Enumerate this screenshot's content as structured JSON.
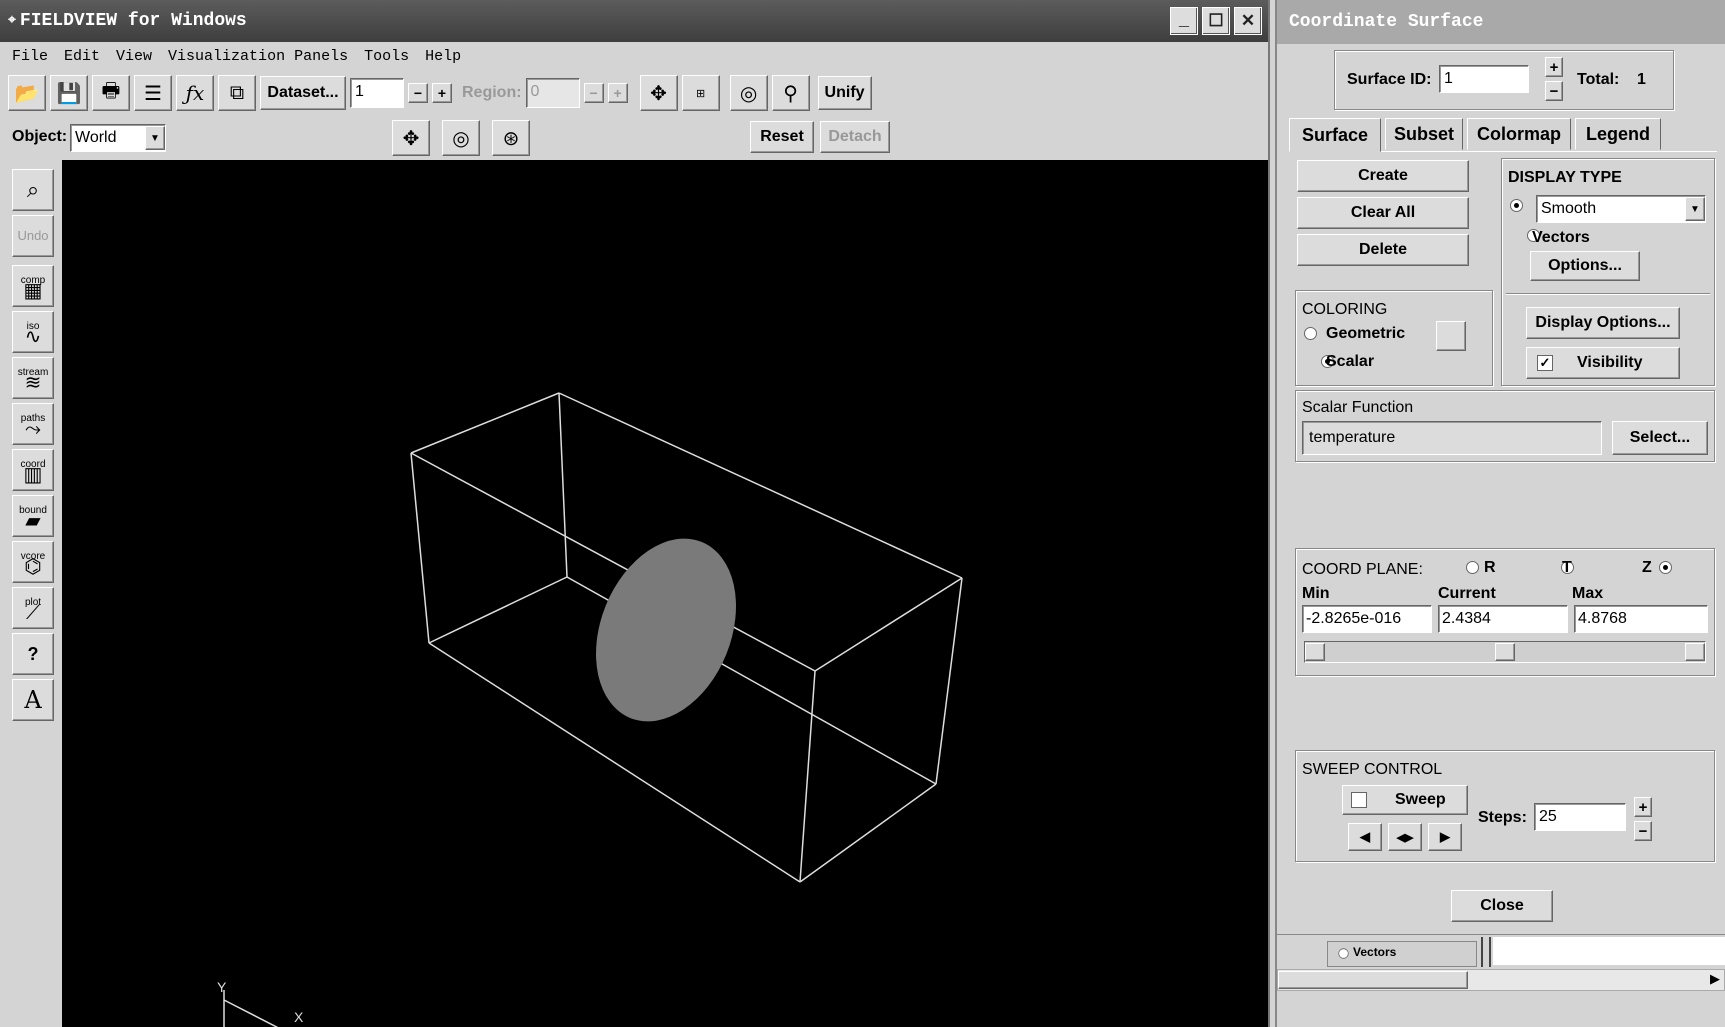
{
  "main_window": {
    "title": "FIELDVIEW for Windows",
    "menu": [
      "File",
      "Edit",
      "View",
      "Visualization Panels",
      "Tools",
      "Help"
    ],
    "toolbar": {
      "dataset_label": "Dataset...",
      "dataset_value": "1",
      "region_label": "Region:",
      "region_value": "0",
      "unify_label": "Unify"
    },
    "object_bar": {
      "label": "Object:",
      "value": "World",
      "reset_label": "Reset",
      "detach_label": "Detach"
    },
    "left_toolbar": [
      {
        "name": "probe",
        "label": ""
      },
      {
        "name": "undo",
        "label": "Undo"
      },
      {
        "name": "comp",
        "label": "comp"
      },
      {
        "name": "iso",
        "label": "iso"
      },
      {
        "name": "stream",
        "label": "stream"
      },
      {
        "name": "paths",
        "label": "paths"
      },
      {
        "name": "coord",
        "label": "coord"
      },
      {
        "name": "bound",
        "label": "bound"
      },
      {
        "name": "vcore",
        "label": "vcore"
      },
      {
        "name": "plot",
        "label": "plot"
      },
      {
        "name": "query",
        "label": "?"
      },
      {
        "name": "text",
        "label": "A"
      }
    ],
    "axis_labels": {
      "y": "Y",
      "x": "X"
    }
  },
  "panel": {
    "title": "Coordinate Surface",
    "surface_id_label": "Surface ID:",
    "surface_id_value": "1",
    "total_label": "Total:",
    "total_value": "1",
    "tabs": [
      "Surface",
      "Subset",
      "Colormap",
      "Legend"
    ],
    "active_tab": "Surface",
    "buttons": {
      "create": "Create",
      "clear_all": "Clear All",
      "delete": "Delete"
    },
    "display_type": {
      "title": "DISPLAY TYPE",
      "smooth": "Smooth",
      "vectors": "Vectors",
      "options": "Options...",
      "display_options": "Display Options...",
      "visibility": "Visibility"
    },
    "coloring": {
      "title": "COLORING",
      "geometric": "Geometric",
      "scalar": "Scalar",
      "selected": "Scalar"
    },
    "scalar_function": {
      "title": "Scalar Function",
      "value": "temperature",
      "select": "Select..."
    },
    "coord_plane": {
      "title": "COORD PLANE:",
      "options": [
        "R",
        "T",
        "Z"
      ],
      "selected": "Z",
      "min_label": "Min",
      "current_label": "Current",
      "max_label": "Max",
      "min_value": "-2.8265e-016",
      "current_value": "2.4384",
      "max_value": "4.8768",
      "slider_fraction": 0.5
    },
    "sweep": {
      "title": "SWEEP CONTROL",
      "sweep_label": "Sweep",
      "steps_label": "Steps:",
      "steps_value": "25"
    },
    "close_label": "Close",
    "underlying_vectors": "Vectors"
  }
}
